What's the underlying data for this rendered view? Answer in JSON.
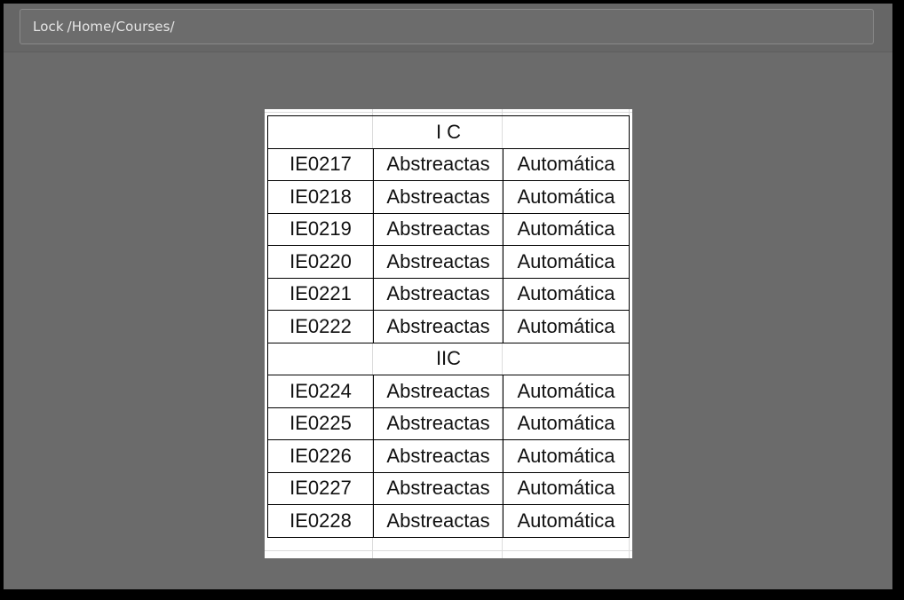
{
  "path_bar": {
    "lock_label": "Lock",
    "path": "/Home/Courses/"
  },
  "table": {
    "groups": [
      {
        "label": "I C",
        "rows": [
          {
            "code": "IE0217",
            "col2": "Abstreactas",
            "col3": "Automática"
          },
          {
            "code": "IE0218",
            "col2": "Abstreactas",
            "col3": "Automática"
          },
          {
            "code": "IE0219",
            "col2": "Abstreactas",
            "col3": "Automática"
          },
          {
            "code": "IE0220",
            "col2": "Abstreactas",
            "col3": "Automática"
          },
          {
            "code": "IE0221",
            "col2": "Abstreactas",
            "col3": "Automática"
          },
          {
            "code": "IE0222",
            "col2": "Abstreactas",
            "col3": "Automática"
          }
        ]
      },
      {
        "label": "IIC",
        "rows": [
          {
            "code": "IE0224",
            "col2": "Abstreactas",
            "col3": "Automática"
          },
          {
            "code": "IE0225",
            "col2": "Abstreactas",
            "col3": "Automática"
          },
          {
            "code": "IE0226",
            "col2": "Abstreactas",
            "col3": "Automática"
          },
          {
            "code": "IE0227",
            "col2": "Abstreactas",
            "col3": "Automática"
          },
          {
            "code": "IE0228",
            "col2": "Abstreactas",
            "col3": "Automática"
          }
        ]
      }
    ]
  }
}
